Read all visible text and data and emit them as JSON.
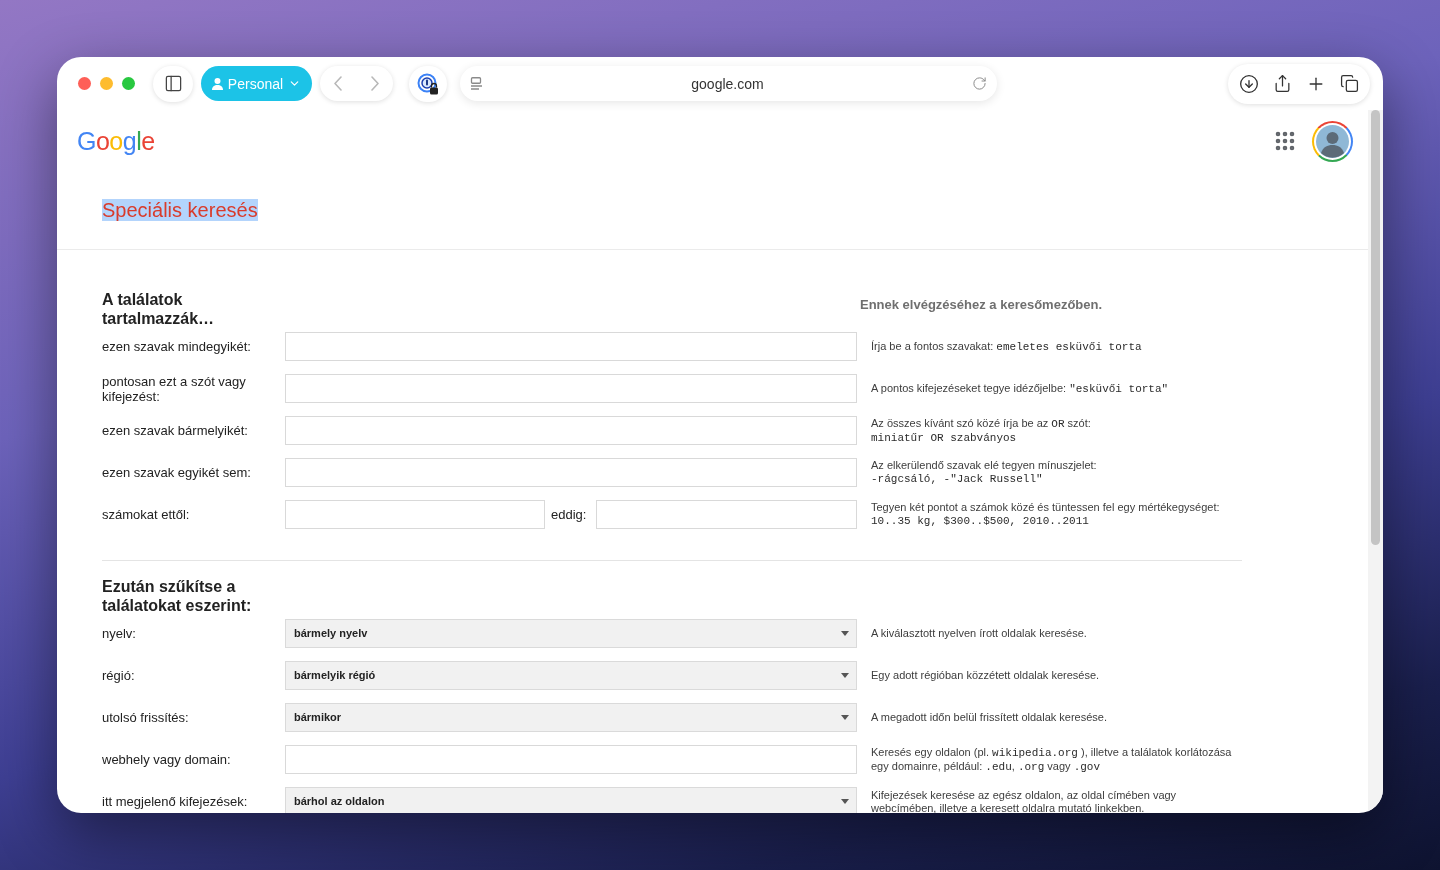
{
  "browser": {
    "profile": "Personal",
    "url": "google.com",
    "back": {
      "disabled": true
    },
    "forward": {
      "disabled": true
    }
  },
  "header": {
    "logo": "Google"
  },
  "title": {
    "text": "Speciális keresés",
    "highlighted": true
  },
  "section_1": {
    "heading": "A találatok tartalmazzák…",
    "hint_heading": "Ennek elvégzéséhez a keresőmezőben.",
    "rows": [
      {
        "kind": "text",
        "label": "ezen szavak mindegyikét:",
        "hint": [
          [
            {
              "kind": "text",
              "text": "Írja be a fontos szavakat: "
            },
            {
              "kind": "code",
              "text": "emeletes esküvői torta"
            }
          ]
        ]
      },
      {
        "kind": "text",
        "label": "pontosan ezt a szót vagy kifejezést:",
        "hint": [
          [
            {
              "kind": "text",
              "text": "A pontos kifejezéseket tegye idézőjelbe: "
            },
            {
              "kind": "code",
              "text": "\"esküvői torta\""
            }
          ]
        ]
      },
      {
        "kind": "text",
        "label": "ezen szavak bármelyikét:",
        "hint": [
          [
            {
              "kind": "text",
              "text": "Az összes kívánt szó közé írja be az "
            },
            {
              "kind": "code",
              "text": "OR"
            },
            {
              "kind": "text",
              "text": " szót:"
            }
          ],
          [
            {
              "kind": "code",
              "text": "miniatűr OR szabványos"
            }
          ]
        ]
      },
      {
        "kind": "text",
        "label": "ezen szavak egyikét sem:",
        "hint": [
          [
            {
              "kind": "text",
              "text": "Az elkerülendő szavak elé tegyen mínuszjelet:"
            }
          ],
          [
            {
              "kind": "code",
              "text": "-rágcsáló, -\"Jack Russell\""
            }
          ]
        ]
      },
      {
        "kind": "range",
        "label": "számokat ettől:",
        "to_label": "eddig:",
        "hint": [
          [
            {
              "kind": "text",
              "text": "Tegyen két pontot a számok közé és tüntessen fel egy mértékegységet:"
            }
          ],
          [
            {
              "kind": "code",
              "text": "10..35 kg, $300..$500, 2010..2011"
            }
          ]
        ]
      }
    ]
  },
  "section_2": {
    "heading": "Ezután szűkítse a találatokat eszerint:",
    "rows": [
      {
        "kind": "select",
        "label": "nyelv:",
        "value": "bármely nyelv",
        "hint": [
          [
            {
              "kind": "text",
              "text": "A kiválasztott nyelven írott oldalak keresése."
            }
          ]
        ]
      },
      {
        "kind": "select",
        "label": "régió:",
        "value": "bármelyik régió",
        "hint": [
          [
            {
              "kind": "text",
              "text": "Egy adott régióban közzétett oldalak keresése."
            }
          ]
        ]
      },
      {
        "kind": "select",
        "label": "utolsó frissítés:",
        "value": "bármikor",
        "hint": [
          [
            {
              "kind": "text",
              "text": "A megadott időn belül frissített oldalak keresése."
            }
          ]
        ]
      },
      {
        "kind": "text",
        "label": "webhely vagy domain:",
        "hint": [
          [
            {
              "kind": "text",
              "text": "Keresés egy oldalon (pl. "
            },
            {
              "kind": "code",
              "text": "wikipedia.org"
            },
            {
              "kind": "text",
              "text": " ), illetve a találatok korlátozása"
            }
          ],
          [
            {
              "kind": "text",
              "text": "egy domainre, például: "
            },
            {
              "kind": "code",
              "text": ".edu"
            },
            {
              "kind": "text",
              "text": ", "
            },
            {
              "kind": "code",
              "text": ".org"
            },
            {
              "kind": "text",
              "text": " vagy "
            },
            {
              "kind": "code",
              "text": ".gov"
            }
          ]
        ]
      },
      {
        "kind": "select",
        "label": "itt megjelenő kifejezések:",
        "value": "bárhol az oldalon",
        "hint": [
          [
            {
              "kind": "text",
              "text": "Kifejezések keresése az egész oldalon, az oldal címében vagy"
            }
          ],
          [
            {
              "kind": "text",
              "text": "webcímében, illetve a keresett oldalra mutató linkekben."
            }
          ]
        ]
      }
    ]
  }
}
